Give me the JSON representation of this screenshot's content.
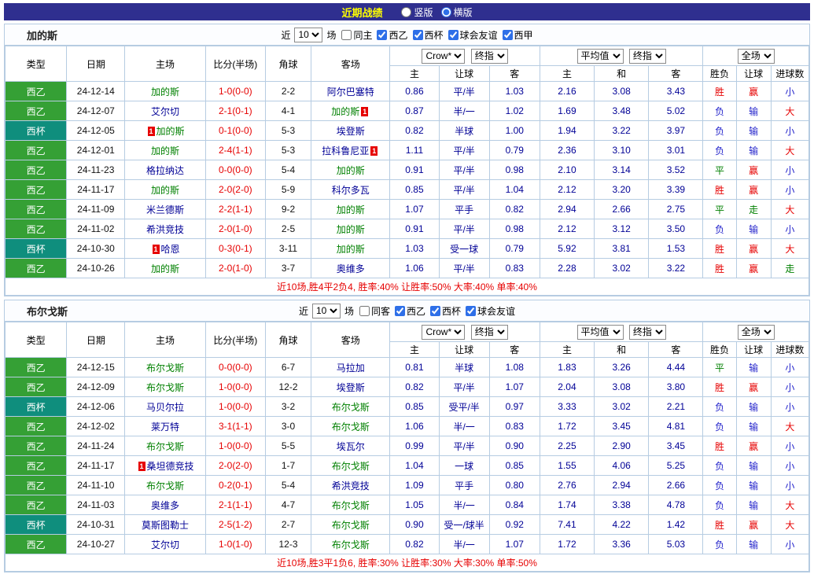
{
  "palette": {
    "bar_bg": "#2f2f8f",
    "title_yellow": "#ffff00",
    "border": "#b6cce2",
    "red": "#e60000",
    "blue": "#2323cb",
    "green": "#008000",
    "navy": "#000096",
    "league_green": "#35a035",
    "league_teal": "#0f8e7d"
  },
  "top_bar": {
    "title": "近期战绩",
    "radios": [
      {
        "label": "竖版",
        "checked": false
      },
      {
        "label": "横版",
        "checked": true
      }
    ]
  },
  "table_header": {
    "col_type": "类型",
    "col_date": "日期",
    "col_home": "主场",
    "col_score": "比分(半场)",
    "col_corner": "角球",
    "col_away": "客场",
    "asian_selects": [
      "Crow*",
      "终指"
    ],
    "euro_selects": [
      "平均值",
      "终指"
    ],
    "scope_select": "全场",
    "sub": [
      "主",
      "让球",
      "客",
      "主",
      "和",
      "客",
      "胜负",
      "让球",
      "进球数"
    ]
  },
  "sections": [
    {
      "team": "加的斯",
      "filter": {
        "near_label": "近",
        "count": "10",
        "games_label": "场",
        "checkboxes": [
          {
            "label": "同主",
            "checked": false
          },
          {
            "label": "西乙",
            "checked": true
          },
          {
            "label": "西杯",
            "checked": true
          },
          {
            "label": "球会友谊",
            "checked": true
          },
          {
            "label": "西甲",
            "checked": true
          }
        ]
      },
      "rows": [
        {
          "league": "西乙",
          "date": "24-12-14",
          "home": "加的斯",
          "home_focus": true,
          "home_rc": "",
          "score": "1-0(0-0)",
          "corner": "2-2",
          "away": "阿尔巴塞特",
          "away_focus": false,
          "away_rc": "",
          "ah": [
            "0.86",
            "平/半",
            "1.03"
          ],
          "eu": [
            "2.16",
            "3.08",
            "3.43"
          ],
          "res": [
            "胜",
            "赢",
            "小"
          ]
        },
        {
          "league": "西乙",
          "date": "24-12-07",
          "home": "艾尔切",
          "home_focus": false,
          "home_rc": "",
          "score": "2-1(0-1)",
          "corner": "4-1",
          "away": "加的斯",
          "away_focus": true,
          "away_rc": "after",
          "ah": [
            "0.87",
            "半/一",
            "1.02"
          ],
          "eu": [
            "1.69",
            "3.48",
            "5.02"
          ],
          "res": [
            "负",
            "输",
            "大"
          ]
        },
        {
          "league": "西杯",
          "date": "24-12-05",
          "home": "加的斯",
          "home_focus": true,
          "home_rc": "before",
          "score": "0-1(0-0)",
          "corner": "5-3",
          "away": "埃登斯",
          "away_focus": false,
          "away_rc": "",
          "ah": [
            "0.82",
            "半球",
            "1.00"
          ],
          "eu": [
            "1.94",
            "3.22",
            "3.97"
          ],
          "res": [
            "负",
            "输",
            "小"
          ]
        },
        {
          "league": "西乙",
          "date": "24-12-01",
          "home": "加的斯",
          "home_focus": true,
          "home_rc": "",
          "score": "2-4(1-1)",
          "corner": "5-3",
          "away": "拉科鲁尼亚",
          "away_focus": false,
          "away_rc": "after",
          "ah": [
            "1.11",
            "平/半",
            "0.79"
          ],
          "eu": [
            "2.36",
            "3.10",
            "3.01"
          ],
          "res": [
            "负",
            "输",
            "大"
          ]
        },
        {
          "league": "西乙",
          "date": "24-11-23",
          "home": "格拉纳达",
          "home_focus": false,
          "home_rc": "",
          "score": "0-0(0-0)",
          "corner": "5-4",
          "away": "加的斯",
          "away_focus": true,
          "away_rc": "",
          "ah": [
            "0.91",
            "平/半",
            "0.98"
          ],
          "eu": [
            "2.10",
            "3.14",
            "3.52"
          ],
          "res": [
            "平",
            "赢",
            "小"
          ]
        },
        {
          "league": "西乙",
          "date": "24-11-17",
          "home": "加的斯",
          "home_focus": true,
          "home_rc": "",
          "score": "2-0(2-0)",
          "corner": "5-9",
          "away": "科尔多瓦",
          "away_focus": false,
          "away_rc": "",
          "ah": [
            "0.85",
            "平/半",
            "1.04"
          ],
          "eu": [
            "2.12",
            "3.20",
            "3.39"
          ],
          "res": [
            "胜",
            "赢",
            "小"
          ]
        },
        {
          "league": "西乙",
          "date": "24-11-09",
          "home": "米兰德斯",
          "home_focus": false,
          "home_rc": "",
          "score": "2-2(1-1)",
          "corner": "9-2",
          "away": "加的斯",
          "away_focus": true,
          "away_rc": "",
          "ah": [
            "1.07",
            "平手",
            "0.82"
          ],
          "eu": [
            "2.94",
            "2.66",
            "2.75"
          ],
          "res": [
            "平",
            "走",
            "大"
          ]
        },
        {
          "league": "西乙",
          "date": "24-11-02",
          "home": "希洪竞技",
          "home_focus": false,
          "home_rc": "",
          "score": "2-0(1-0)",
          "corner": "2-5",
          "away": "加的斯",
          "away_focus": true,
          "away_rc": "",
          "ah": [
            "0.91",
            "平/半",
            "0.98"
          ],
          "eu": [
            "2.12",
            "3.12",
            "3.50"
          ],
          "res": [
            "负",
            "输",
            "小"
          ]
        },
        {
          "league": "西杯",
          "date": "24-10-30",
          "home": "哈恩",
          "home_focus": false,
          "home_rc": "before",
          "score": "0-3(0-1)",
          "corner": "3-11",
          "away": "加的斯",
          "away_focus": true,
          "away_rc": "",
          "ah": [
            "1.03",
            "受一球",
            "0.79"
          ],
          "eu": [
            "5.92",
            "3.81",
            "1.53"
          ],
          "res": [
            "胜",
            "赢",
            "大"
          ]
        },
        {
          "league": "西乙",
          "date": "24-10-26",
          "home": "加的斯",
          "home_focus": true,
          "home_rc": "",
          "score": "2-0(1-0)",
          "corner": "3-7",
          "away": "奥维多",
          "away_focus": false,
          "away_rc": "",
          "ah": [
            "1.06",
            "平/半",
            "0.83"
          ],
          "eu": [
            "2.28",
            "3.02",
            "3.22"
          ],
          "res": [
            "胜",
            "赢",
            "走"
          ]
        }
      ],
      "footer": "近10场,胜4平2负4, 胜率:40% 让胜率:50% 大率:40% 单率:40%"
    },
    {
      "team": "布尔戈斯",
      "filter": {
        "near_label": "近",
        "count": "10",
        "games_label": "场",
        "checkboxes": [
          {
            "label": "同客",
            "checked": false
          },
          {
            "label": "西乙",
            "checked": true
          },
          {
            "label": "西杯",
            "checked": true
          },
          {
            "label": "球会友谊",
            "checked": true
          }
        ]
      },
      "rows": [
        {
          "league": "西乙",
          "date": "24-12-15",
          "home": "布尔戈斯",
          "home_focus": true,
          "home_rc": "",
          "score": "0-0(0-0)",
          "corner": "6-7",
          "away": "马拉加",
          "away_focus": false,
          "away_rc": "",
          "ah": [
            "0.81",
            "半球",
            "1.08"
          ],
          "eu": [
            "1.83",
            "3.26",
            "4.44"
          ],
          "res": [
            "平",
            "输",
            "小"
          ]
        },
        {
          "league": "西乙",
          "date": "24-12-09",
          "home": "布尔戈斯",
          "home_focus": true,
          "home_rc": "",
          "score": "1-0(0-0)",
          "corner": "12-2",
          "away": "埃登斯",
          "away_focus": false,
          "away_rc": "",
          "ah": [
            "0.82",
            "平/半",
            "1.07"
          ],
          "eu": [
            "2.04",
            "3.08",
            "3.80"
          ],
          "res": [
            "胜",
            "赢",
            "小"
          ]
        },
        {
          "league": "西杯",
          "date": "24-12-06",
          "home": "马贝尔拉",
          "home_focus": false,
          "home_rc": "",
          "score": "1-0(0-0)",
          "corner": "3-2",
          "away": "布尔戈斯",
          "away_focus": true,
          "away_rc": "",
          "ah": [
            "0.85",
            "受平/半",
            "0.97"
          ],
          "eu": [
            "3.33",
            "3.02",
            "2.21"
          ],
          "res": [
            "负",
            "输",
            "小"
          ]
        },
        {
          "league": "西乙",
          "date": "24-12-02",
          "home": "莱万特",
          "home_focus": false,
          "home_rc": "",
          "score": "3-1(1-1)",
          "corner": "3-0",
          "away": "布尔戈斯",
          "away_focus": true,
          "away_rc": "",
          "ah": [
            "1.06",
            "半/一",
            "0.83"
          ],
          "eu": [
            "1.72",
            "3.45",
            "4.81"
          ],
          "res": [
            "负",
            "输",
            "大"
          ]
        },
        {
          "league": "西乙",
          "date": "24-11-24",
          "home": "布尔戈斯",
          "home_focus": true,
          "home_rc": "",
          "score": "1-0(0-0)",
          "corner": "5-5",
          "away": "埃瓦尔",
          "away_focus": false,
          "away_rc": "",
          "ah": [
            "0.99",
            "平/半",
            "0.90"
          ],
          "eu": [
            "2.25",
            "2.90",
            "3.45"
          ],
          "res": [
            "胜",
            "赢",
            "小"
          ]
        },
        {
          "league": "西乙",
          "date": "24-11-17",
          "home": "桑坦德竞技",
          "home_focus": false,
          "home_rc": "before",
          "score": "2-0(2-0)",
          "corner": "1-7",
          "away": "布尔戈斯",
          "away_focus": true,
          "away_rc": "",
          "ah": [
            "1.04",
            "一球",
            "0.85"
          ],
          "eu": [
            "1.55",
            "4.06",
            "5.25"
          ],
          "res": [
            "负",
            "输",
            "小"
          ]
        },
        {
          "league": "西乙",
          "date": "24-11-10",
          "home": "布尔戈斯",
          "home_focus": true,
          "home_rc": "",
          "score": "0-2(0-1)",
          "corner": "5-4",
          "away": "希洪竞技",
          "away_focus": false,
          "away_rc": "",
          "ah": [
            "1.09",
            "平手",
            "0.80"
          ],
          "eu": [
            "2.76",
            "2.94",
            "2.66"
          ],
          "res": [
            "负",
            "输",
            "小"
          ]
        },
        {
          "league": "西乙",
          "date": "24-11-03",
          "home": "奥维多",
          "home_focus": false,
          "home_rc": "",
          "score": "2-1(1-1)",
          "corner": "4-7",
          "away": "布尔戈斯",
          "away_focus": true,
          "away_rc": "",
          "ah": [
            "1.05",
            "半/一",
            "0.84"
          ],
          "eu": [
            "1.74",
            "3.38",
            "4.78"
          ],
          "res": [
            "负",
            "输",
            "大"
          ]
        },
        {
          "league": "西杯",
          "date": "24-10-31",
          "home": "莫斯图勒士",
          "home_focus": false,
          "home_rc": "",
          "score": "2-5(1-2)",
          "corner": "2-7",
          "away": "布尔戈斯",
          "away_focus": true,
          "away_rc": "",
          "ah": [
            "0.90",
            "受一/球半",
            "0.92"
          ],
          "eu": [
            "7.41",
            "4.22",
            "1.42"
          ],
          "res": [
            "胜",
            "赢",
            "大"
          ]
        },
        {
          "league": "西乙",
          "date": "24-10-27",
          "home": "艾尔切",
          "home_focus": false,
          "home_rc": "",
          "score": "1-0(1-0)",
          "corner": "12-3",
          "away": "布尔戈斯",
          "away_focus": true,
          "away_rc": "",
          "ah": [
            "0.82",
            "半/一",
            "1.07"
          ],
          "eu": [
            "1.72",
            "3.36",
            "5.03"
          ],
          "res": [
            "负",
            "输",
            "小"
          ]
        }
      ],
      "footer": "近10场,胜3平1负6, 胜率:30% 让胜率:30% 大率:30% 单率:50%"
    }
  ]
}
